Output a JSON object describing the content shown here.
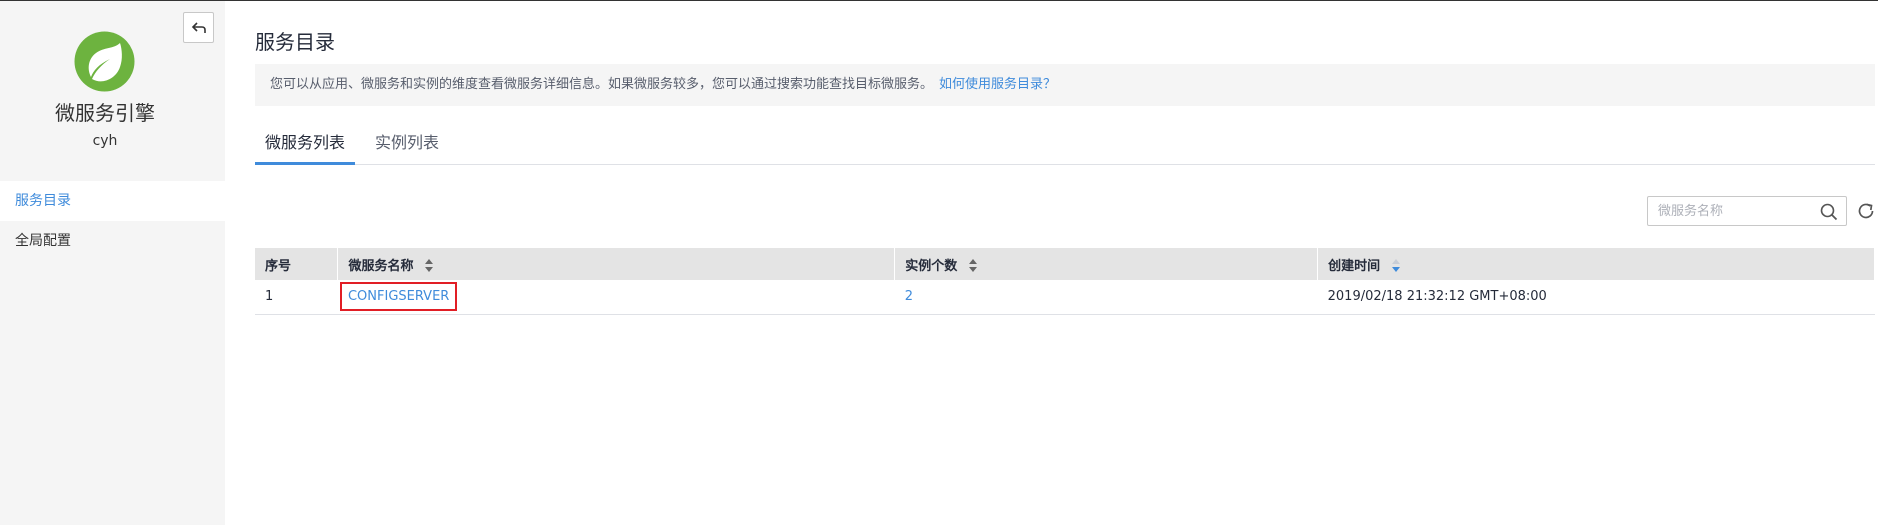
{
  "sidebar": {
    "app_title": "微服务引擎",
    "app_sub": "cyh",
    "items": [
      {
        "label": "服务目录",
        "active": true
      },
      {
        "label": "全局配置",
        "active": false
      }
    ]
  },
  "main": {
    "page_title": "服务目录",
    "info_text": "您可以从应用、微服务和实例的维度查看微服务详细信息。如果微服务较多，您可以通过搜索功能查找目标微服务。",
    "help_link": "如何使用服务目录？",
    "tabs": [
      {
        "label": "微服务列表",
        "active": true
      },
      {
        "label": "实例列表",
        "active": false
      }
    ],
    "search": {
      "placeholder": "微服务名称",
      "value": ""
    },
    "table": {
      "headers": [
        "序号",
        "微服务名称",
        "实例个数",
        "创建时间"
      ],
      "rows": [
        {
          "index": "1",
          "name": "CONFIGSERVER",
          "instances": "2",
          "created": "2019/02/18 21:32:12 GMT+08:00"
        }
      ]
    }
  },
  "colors": {
    "accent": "#3f8bdb",
    "highlight": "#e11e25",
    "logo": "#6db33f"
  }
}
